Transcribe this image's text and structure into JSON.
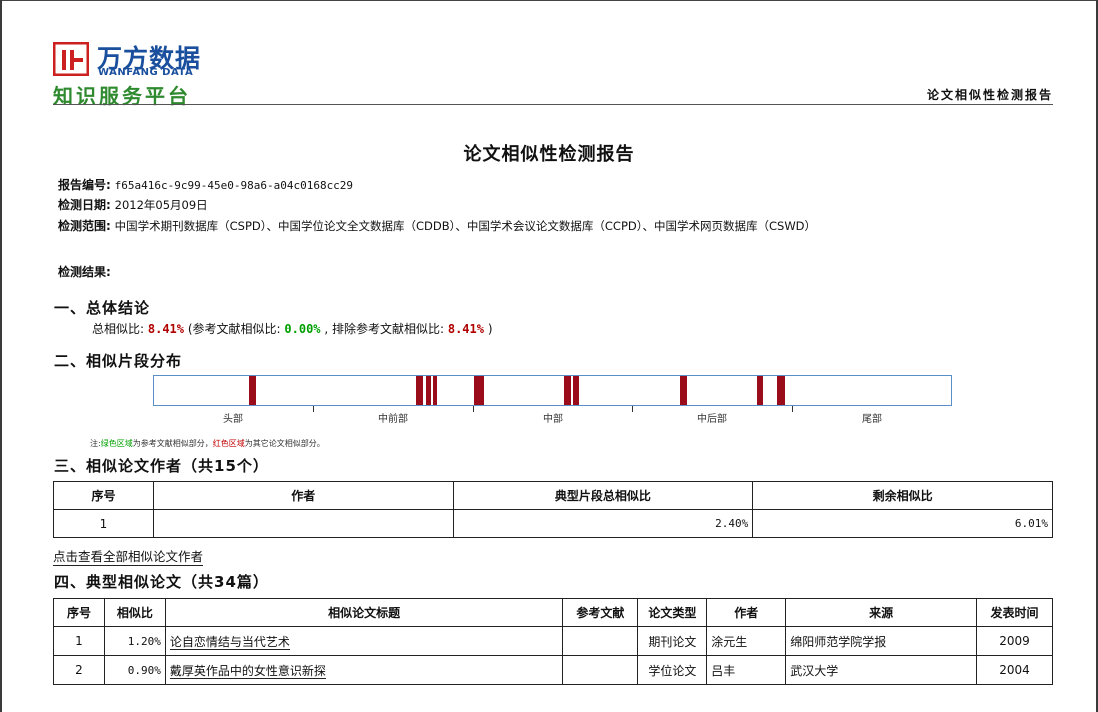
{
  "brand": {
    "name_cn": "万方数据",
    "name_en": "WANFANG DATA",
    "tagline": "知识服务平台",
    "colors": {
      "primary": "#1a4f9e",
      "accent": "#cc1f1f",
      "tagline": "#2f8a2f"
    }
  },
  "header": {
    "right_title": "论文相似性检测报告"
  },
  "report": {
    "title": "论文相似性检测报告",
    "id_label": "报告编号:",
    "id_value": "f65a416c-9c99-45e0-98a6-a04c0168cc29",
    "date_label": "检测日期:",
    "date_value": "2012年05月09日",
    "scope_label": "检测范围:",
    "scope_value": "中国学术期刊数据库（CSPD）、中国学位论文全文数据库（CDDB）、中国学术会议论文数据库（CCPD）、中国学术网页数据库（CSWD）",
    "result_label": "检测结果:"
  },
  "section1": {
    "title": "一、总体结论",
    "total_label": "总相似比:",
    "total_value": "8.41%",
    "ref_label": "(参考文献相似比:",
    "ref_value": "0.00%",
    "excl_label": ", 排除参考文献相似比:",
    "excl_value": "8.41%",
    "close": ")"
  },
  "section2": {
    "title": "二、相似片段分布",
    "axis_labels": [
      "头部",
      "中前部",
      "中部",
      "中后部",
      "尾部"
    ],
    "segments_fraction": [
      {
        "start": 0.119,
        "width": 0.009
      },
      {
        "start": 0.329,
        "width": 0.009
      },
      {
        "start": 0.341,
        "width": 0.006
      },
      {
        "start": 0.35,
        "width": 0.005
      },
      {
        "start": 0.401,
        "width": 0.012
      },
      {
        "start": 0.514,
        "width": 0.009
      },
      {
        "start": 0.526,
        "width": 0.008
      },
      {
        "start": 0.66,
        "width": 0.009
      },
      {
        "start": 0.756,
        "width": 0.008
      },
      {
        "start": 0.782,
        "width": 0.01
      }
    ],
    "segment_color": "#9a0c1a",
    "note_prefix": "注:",
    "note_green": "绿色区域",
    "note_mid": "为参考文献相似部分，",
    "note_red": "红色区域",
    "note_suffix": "为其它论文相似部分。"
  },
  "section3": {
    "title": "三、相似论文作者（共15个）",
    "headers": [
      "序号",
      "作者",
      "典型片段总相似比",
      "剩余相似比"
    ],
    "rows": [
      {
        "no": "1",
        "author": "",
        "typical": "2.40%",
        "remaining": "6.01%"
      }
    ],
    "link": "点击查看全部相似论文作者"
  },
  "section4": {
    "title": "四、典型相似论文（共34篇）",
    "headers": [
      "序号",
      "相似比",
      "相似论文标题",
      "参考文献",
      "论文类型",
      "作者",
      "来源",
      "发表时间"
    ],
    "rows": [
      {
        "no": "1",
        "ratio": "1.20%",
        "title": "论自恋情结与当代艺术",
        "ref": "",
        "type": "期刊论文",
        "author": "涂元生",
        "source": "绵阳师范学院学报",
        "year": "2009"
      },
      {
        "no": "2",
        "ratio": "0.90%",
        "title": "戴厚英作品中的女性意识新探",
        "ref": "",
        "type": "学位论文",
        "author": "吕丰",
        "source": "武汉大学",
        "year": "2004"
      }
    ]
  }
}
